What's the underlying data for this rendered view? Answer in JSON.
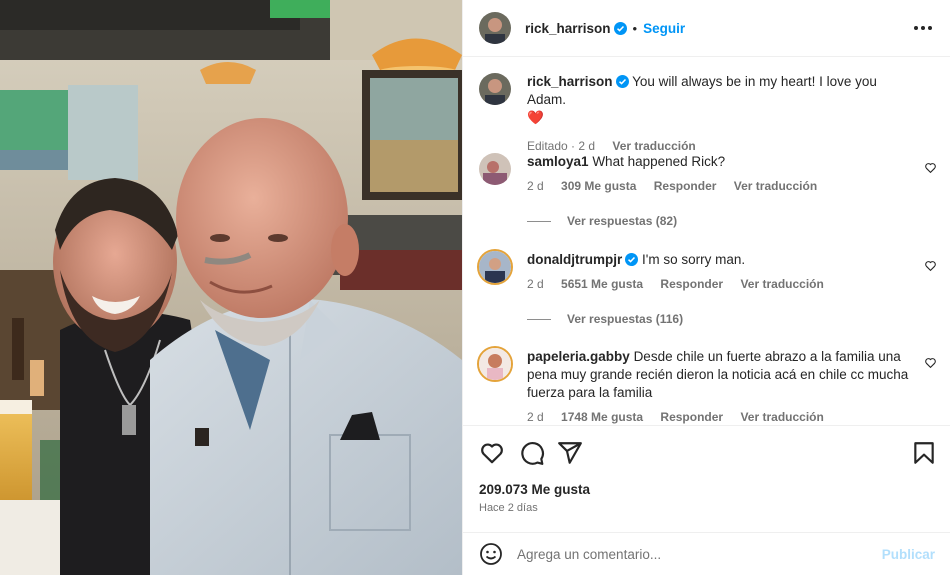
{
  "header": {
    "username": "rick_harrison",
    "separator": "•",
    "follow_label": "Seguir"
  },
  "caption": {
    "username": "rick_harrison",
    "text": "You will always be in my heart! I love you Adam.",
    "emoji": "❤️",
    "meta_edited": "Editado · 2 d",
    "translate": "Ver traducción"
  },
  "comments": [
    {
      "username": "samloya1",
      "text": "What happened Rick?",
      "time": "2 d",
      "likes": "309 Me gusta",
      "reply": "Responder",
      "translate": "Ver traducción",
      "view_replies": "Ver respuestas (82)"
    },
    {
      "username": "donaldjtrumpjr",
      "text": "I'm so sorry man.",
      "time": "2 d",
      "likes": "5651 Me gusta",
      "reply": "Responder",
      "translate": "Ver traducción",
      "view_replies": "Ver respuestas (116)"
    },
    {
      "username": "papeleria.gabby",
      "text": "Desde chile un fuerte abrazo a la familia una pena muy grande recién dieron la noticia acá en chile cc mucha fuerza para la familia",
      "time": "2 d",
      "likes": "1748 Me gusta",
      "reply": "Responder",
      "translate": "Ver traducción"
    }
  ],
  "post": {
    "likes": "209.073 Me gusta",
    "ago": "Hace 2 días"
  },
  "composer": {
    "placeholder": "Agrega un comentario...",
    "publish": "Publicar"
  },
  "icons": {
    "verified": "verified-badge-icon",
    "more": "more-options-icon",
    "like": "heart-icon",
    "comment": "comment-icon",
    "share": "share-icon",
    "save": "bookmark-icon",
    "emoji": "emoji-icon"
  },
  "colors": {
    "accent": "#0095f6",
    "publish_disabled": "#b2dffc",
    "muted": "#737373",
    "heart": "#c0182e"
  }
}
